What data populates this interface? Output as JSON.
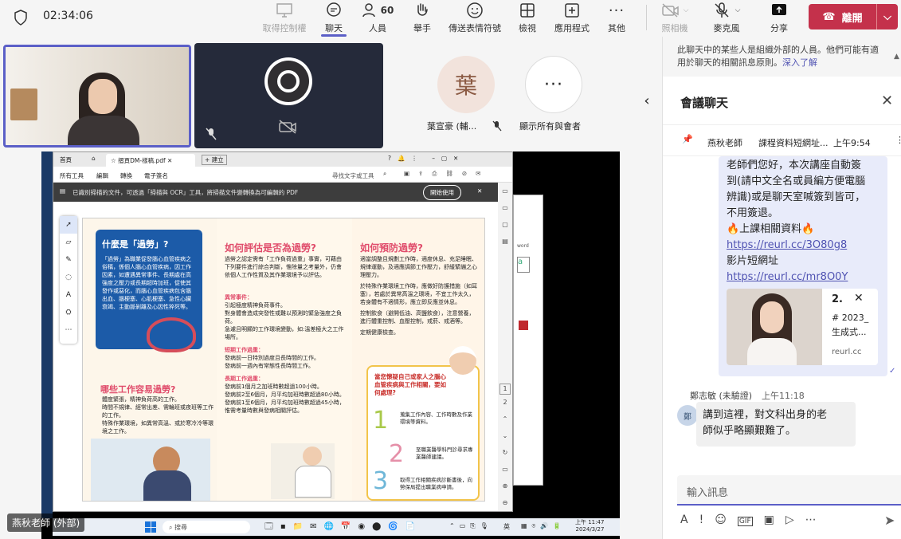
{
  "topbar": {
    "shield_icon": "shield-icon",
    "timer": "02:34:06",
    "items": [
      {
        "label": "取得控制權",
        "icon": "monitor-control-icon",
        "disabled": true
      },
      {
        "label": "聊天",
        "icon": "chat-icon"
      },
      {
        "label": "人員",
        "icon": "people-icon",
        "count": "60"
      },
      {
        "label": "舉手",
        "icon": "hand-icon"
      },
      {
        "label": "傳送表情符號",
        "icon": "emoji-icon"
      },
      {
        "label": "檢視",
        "icon": "grid-icon"
      },
      {
        "label": "應用程式",
        "icon": "add-app-icon"
      },
      {
        "label": "其他",
        "icon": "more-icon"
      },
      {
        "label": "照相機",
        "icon": "camera-off-icon",
        "disabled": true
      },
      {
        "label": "麥克風",
        "icon": "mic-off-icon"
      },
      {
        "label": "分享",
        "icon": "share-icon"
      }
    ],
    "leave": "離開"
  },
  "stage": {
    "tile_avatar_initial": "葉",
    "tile_avatar_name": "葉宣豪 (輔...",
    "show_all": "顯示所有與會者",
    "presenter_label": "燕秋老師 (外部)"
  },
  "chat": {
    "notice": "此聊天中的某些人是組織外部的人員。他們可能有適用於聊天的相關訊息原則。",
    "notice_link": "深入了解",
    "title": "會議聊天",
    "pinned_sender": "燕秋老師",
    "pinned_text": "課程資料短網址...",
    "pinned_time": "上午9:54",
    "msg1_lines": [
      "老師們您好，本次講座自動簽",
      "到(請中文全名或員編方便電腦",
      "辨識)或是聊天室喊簽到皆可，",
      "不用簽退。"
    ],
    "msg1_fire": "🔥上課相關資料🔥",
    "msg1_link1": "https://reurl.cc/3O80g8",
    "msg1_video": "影片短網址",
    "msg1_link2": "https://reurl.cc/mr8O0Y",
    "preview_num": "2.",
    "preview_line1": "# 2023_",
    "preview_line2": "生成式...",
    "preview_domain": "reurl.cc",
    "msg2_sender": "鄭志敏 (未驗證)",
    "msg2_time": "上午11:18",
    "msg2_avatar": "鄭",
    "msg2_lines": [
      "講到這裡，對文科出身的老",
      "師似乎略顯艱難了。"
    ],
    "input_placeholder": "輸入訊息"
  },
  "pdf": {
    "tab1": "首頁",
    "tab2": "摺頁DM-樣稿.pdf",
    "newtab": "+ 建立",
    "menu": [
      "所有工具",
      "編輯",
      "轉換",
      "電子簽名"
    ],
    "search": "尋找文字或工具",
    "banner": "已識別掃描的文件，可透過「掃描與 OCR」工具，將掃描文件變轉換為可編輯的 PDF",
    "banner_btn": "開始使用",
    "h1": "什麼是「過勞」?",
    "p1": "「過勞」為職業促發腦心血管疾病之俗稱，係個人腦心血管疾病，因工作因素，如遭遇異常事件、長期處在高強度之壓力或長期超時加班，促使其發作或惡化，而腦心血管疾病包含腦出血、腦梗塞、心肌梗塞、急性心臟衰竭、主動脈剝離及心因性猝死等。",
    "h2": "如何評估是否為過勞?",
    "p2": "過勞之認定需有「工作負荷過重」事實，可藉由下列要件進行綜合判斷，惟除量之考量外，仍會依個人工作性質及其作業環境予以評估。",
    "s2a": "異常事件：",
    "s2a_items": [
      "引起極度精神負荷事件。",
      "對身體會造成突發性或難以預測的緊急強度之負荷。",
      "急遽且明顯的工作環境變動，如:溫差極大之工作場所。"
    ],
    "s2b": "短期工作過重：",
    "s2b_items": [
      "發病前一日特別過度且長時間的工作。",
      "發病前一週內有常態性長時間工作。"
    ],
    "s2c": "長期工作過重：",
    "s2c_items": [
      "發病前1個月之加班時數超過100小時。",
      "發病前2至6個月，月平均加班時數超過80小時。",
      "發病前1至6個月，月平均加班時數超過45小時，惟需考量時數與發病相關評估。"
    ],
    "h3": "如何預防過勞?",
    "h3_items": [
      "適當調整且規劃工作時，適度休息、充足睡眠、規律運動，及適應調節工作壓力，舒緩緊繃之心理壓力。",
      "於特殊作業環境工作時，應做好防護措施（如耳塞），若處於異常高溫之環境，不宜工作太久，若身體有不適情形，應立即反應並休息。",
      "控制飲食（避開低油、高鹽飲食），注意營養，進行體重控制、血壓控制，戒菸、戒酒等。",
      "定期健康檢查。"
    ],
    "h4": "哪些工作容易過勞?",
    "h4_items": [
      "體度緊張，精神負荷高的工作。",
      "時間不規律、經常出差、需輪班或夜班等工作的工作。",
      "特殊作業環境，如異常高溫、或於寒冷冷等環境之工作。"
    ],
    "box_title": "當您懷疑自己或家人之腦心血管疾病與工作相關，要如何處理?",
    "box_items": [
      "蒐集工作內容、工作時數及作業環境等資料。",
      "至職業醫學科門診尋求專業醫師建議。",
      "取得工作相關疾病診斷書後，向勞保局提出職業病申請。"
    ],
    "page_nums": [
      "1",
      "2"
    ],
    "taskbar_search": "搜尋",
    "taskbar_lang": "英",
    "taskbar_time": "上午 11:47",
    "taskbar_date": "2024/3/27"
  }
}
